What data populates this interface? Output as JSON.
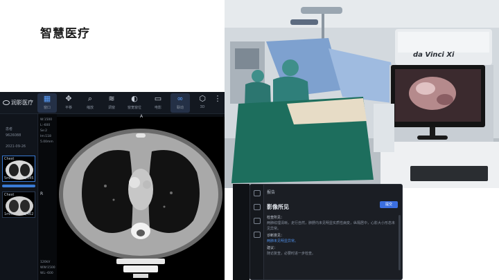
{
  "slide": {
    "title": "智慧医疗"
  },
  "or_photo": {
    "console_brand": "da Vinci Xi"
  },
  "viewer": {
    "logo_text": "润影医疗",
    "toolbar": [
      {
        "icon": "grid-icon",
        "glyph": "▦",
        "label": "窗口",
        "active": true
      },
      {
        "icon": "move-icon",
        "glyph": "✥",
        "label": "平移",
        "active": false
      },
      {
        "icon": "zoom-icon",
        "glyph": "⌕",
        "label": "缩放",
        "active": false
      },
      {
        "icon": "layers-icon",
        "glyph": "≋",
        "label": "调窗",
        "active": false
      },
      {
        "icon": "contrast-icon",
        "glyph": "◐",
        "label": "窗宽窗位",
        "active": false
      },
      {
        "icon": "film-icon",
        "glyph": "▭",
        "label": "电影",
        "active": false
      },
      {
        "icon": "link-icon",
        "glyph": "∞",
        "label": "联动",
        "active": true
      },
      {
        "icon": "cube-icon",
        "glyph": "⬡",
        "label": "3D",
        "active": false
      },
      {
        "icon": "more-icon",
        "glyph": "⋮",
        "label": "更多",
        "active": false
      }
    ],
    "side": {
      "patient_label": "患者",
      "patient_id": "9626088",
      "study_date": "2021-09-26"
    },
    "series": [
      {
        "title": "Chest",
        "count": "1/345",
        "top_left": "5mm"
      },
      {
        "title": "Chest",
        "count": "1/462",
        "top_left": "1mm"
      }
    ],
    "info_lines": [
      "W:1500",
      "L:-600",
      "Se:2",
      "Im:118",
      "5.00mm",
      "R",
      "120kV",
      "WW:1500",
      "WL:-600"
    ],
    "orientation": {
      "top": "A",
      "left": "R",
      "right": "L"
    }
  },
  "report": {
    "header": "报告",
    "title": "影像所见",
    "button": "提交",
    "sections": [
      {
        "heading": "检查所见：",
        "text": "两肺纹理清晰，走行自然，肺野内未见明显实质性病变，纵隔居中，心影大小形态未见异常。"
      },
      {
        "heading": "诊断意见：",
        "text": "两肺未见明显异常。",
        "highlight": true
      },
      {
        "heading": "建议：",
        "text": "随访复查，必要时进一步检查。"
      }
    ]
  }
}
